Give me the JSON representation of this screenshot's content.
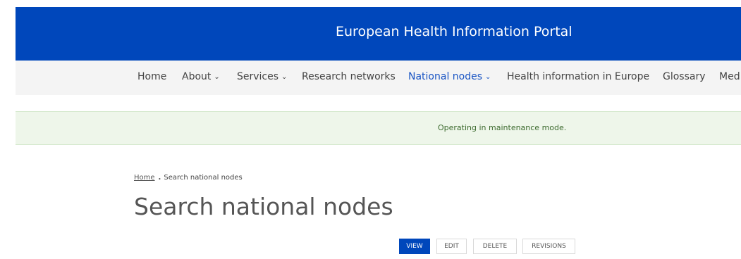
{
  "header": {
    "title": "European Health Information Portal"
  },
  "nav": {
    "items": [
      {
        "label": "Home",
        "dropdown": false,
        "active": false
      },
      {
        "label": "About",
        "dropdown": true,
        "active": false
      },
      {
        "label": "Services",
        "dropdown": true,
        "active": false
      },
      {
        "label": "Research networks",
        "dropdown": false,
        "active": false
      },
      {
        "label": "National nodes",
        "dropdown": true,
        "active": true
      },
      {
        "label": "Health information in Europe",
        "dropdown": false,
        "active": false
      },
      {
        "label": "Glossary",
        "dropdown": false,
        "active": false
      },
      {
        "label": "Med",
        "dropdown": false,
        "active": false
      }
    ],
    "chevron": "⌄"
  },
  "notice": {
    "message": "Operating in maintenance mode."
  },
  "breadcrumb": {
    "home": "Home",
    "separator": ".",
    "current": "Search national nodes"
  },
  "page": {
    "title": "Search national nodes"
  },
  "tabs": [
    {
      "label": "VIEW",
      "active": true
    },
    {
      "label": "EDIT",
      "active": false
    },
    {
      "label": "DELETE",
      "active": false
    },
    {
      "label": "REVISIONS",
      "active": false
    }
  ],
  "colors": {
    "brand_blue": "#0047bb",
    "active_nav": "#1a55c4",
    "notice_bg": "#eef6ea",
    "notice_text": "#3d6b2f"
  }
}
